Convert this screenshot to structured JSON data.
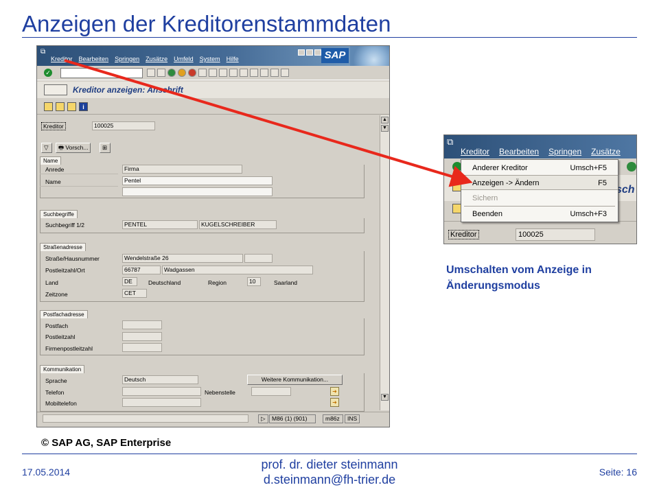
{
  "slide": {
    "title": "Anzeigen der Kreditorenstammdaten",
    "copyright": "© SAP AG, SAP Enterprise",
    "caption": "Umschalten vom Anzeige in Änderungsmodus",
    "footer_date": "17.05.2014",
    "footer_author": "prof. dr. dieter steinmann",
    "footer_email": "d.steinmann@fh-trier.de",
    "footer_page": "Seite: 16"
  },
  "sap": {
    "menu": [
      "Kreditor",
      "Bearbeiten",
      "Springen",
      "Zusätze",
      "Umfeld",
      "System",
      "Hilfe"
    ],
    "logo": "SAP",
    "screen_title": "Kreditor anzeigen: Anschrift",
    "kreditor_label": "Kreditor",
    "kreditor_value": "100025",
    "preview_button": "Vorsch...",
    "groups": {
      "name": {
        "title": "Name",
        "anrede_label": "Anrede",
        "anrede_value": "Firma",
        "name_label": "Name",
        "name_value": "Pentel"
      },
      "suchbegriffe": {
        "title": "Suchbegriffe",
        "label": "Suchbegriff 1/2",
        "value1": "PENTEL",
        "value2": "KUGELSCHREIBER"
      },
      "strasse": {
        "title": "Straßenadresse",
        "strasse_label": "Straße/Hausnummer",
        "strasse_value": "Wendelstraße 26",
        "plz_label": "Postleitzahl/Ort",
        "plz_value": "66787",
        "ort_value": "Wadgassen",
        "land_label": "Land",
        "land_code": "DE",
        "land_name": "Deutschland",
        "region_label": "Region",
        "region_code": "10",
        "region_name": "Saarland",
        "zeitzone_label": "Zeitzone",
        "zeitzone_value": "CET"
      },
      "postfach": {
        "title": "Postfachadresse",
        "postfach_label": "Postfach",
        "postleitzahl_label": "Postleitzahl",
        "firmen_label": "Firmenpostleitzahl"
      },
      "kommunikation": {
        "title": "Kommunikation",
        "sprache_label": "Sprache",
        "sprache_value": "Deutsch",
        "more_button": "Weitere Kommunikation...",
        "telefon_label": "Telefon",
        "nebenstelle_label": "Nebenstelle",
        "mobil_label": "Mobiltelefon"
      }
    },
    "status": {
      "system": "M86 (1) (901)",
      "server": "m86z",
      "mode": "INS"
    }
  },
  "zoom": {
    "menu": [
      "Kreditor",
      "Bearbeiten",
      "Springen",
      "Zusätze"
    ],
    "title_partial": "sch",
    "dropdown": [
      {
        "label": "Anderer Kreditor",
        "shortcut": "Umsch+F5"
      },
      {
        "label": "Anzeigen -> Ändern",
        "shortcut": "F5"
      },
      {
        "label": "Sichern",
        "shortcut": ""
      },
      {
        "label": "Beenden",
        "shortcut": "Umsch+F3"
      }
    ],
    "kreditor_label": "Kreditor",
    "kreditor_value": "100025"
  }
}
